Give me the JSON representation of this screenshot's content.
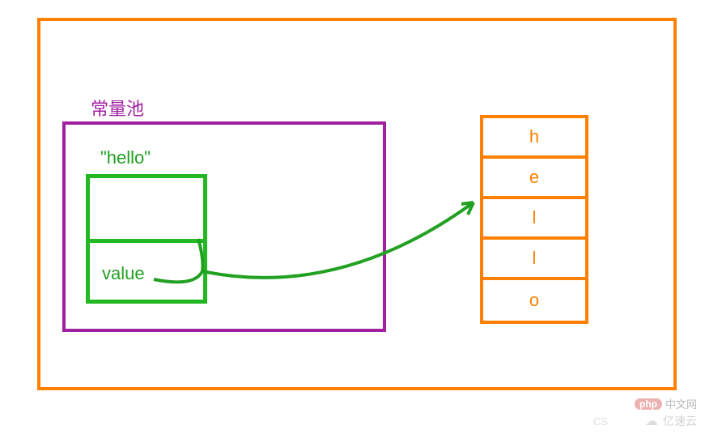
{
  "diagram": {
    "constant_pool_label": "常量池",
    "string_literal": "\"hello\"",
    "value_field": "value",
    "array_cells": [
      "h",
      "e",
      "l",
      "l",
      "o"
    ]
  },
  "watermarks": {
    "php_badge": "php",
    "php_text": "中文网",
    "cs_text": "CS",
    "cloud_text": "亿速云"
  },
  "colors": {
    "orange": "#ff7f00",
    "purple": "#a020a0",
    "green": "#22b822"
  }
}
